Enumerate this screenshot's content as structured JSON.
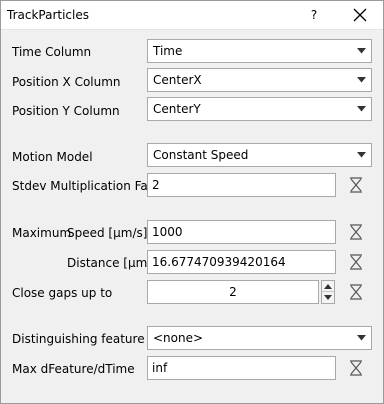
{
  "window": {
    "title": "TrackParticles",
    "help_label": "?"
  },
  "fields": {
    "time_column": {
      "label": "Time Column",
      "value": "Time"
    },
    "position_x_column": {
      "label": "Position X Column",
      "value": "CenterX"
    },
    "position_y_column": {
      "label": "Position Y Column",
      "value": "CenterY"
    },
    "motion_model": {
      "label": "Motion Model",
      "value": "Constant Speed"
    },
    "stdev_factor": {
      "label": "Stdev Multiplication Factor",
      "value": "2"
    },
    "maximum": {
      "label": "Maximum"
    },
    "max_speed": {
      "label": "Speed [µm/s]",
      "value": "1000"
    },
    "max_distance": {
      "label": "Distance [µm]",
      "value": "16.677470939420164"
    },
    "close_gaps": {
      "label": "Close gaps up to",
      "value": "2"
    },
    "distinguishing_feature": {
      "label": "Distinguishing feature",
      "value": "<none>"
    },
    "max_dfeature": {
      "label": "Max dFeature/dTime",
      "value": "inf"
    }
  },
  "icons": {
    "reset": "reset-default-icon",
    "dropdown": "chevron-down-icon",
    "close": "close-icon"
  }
}
